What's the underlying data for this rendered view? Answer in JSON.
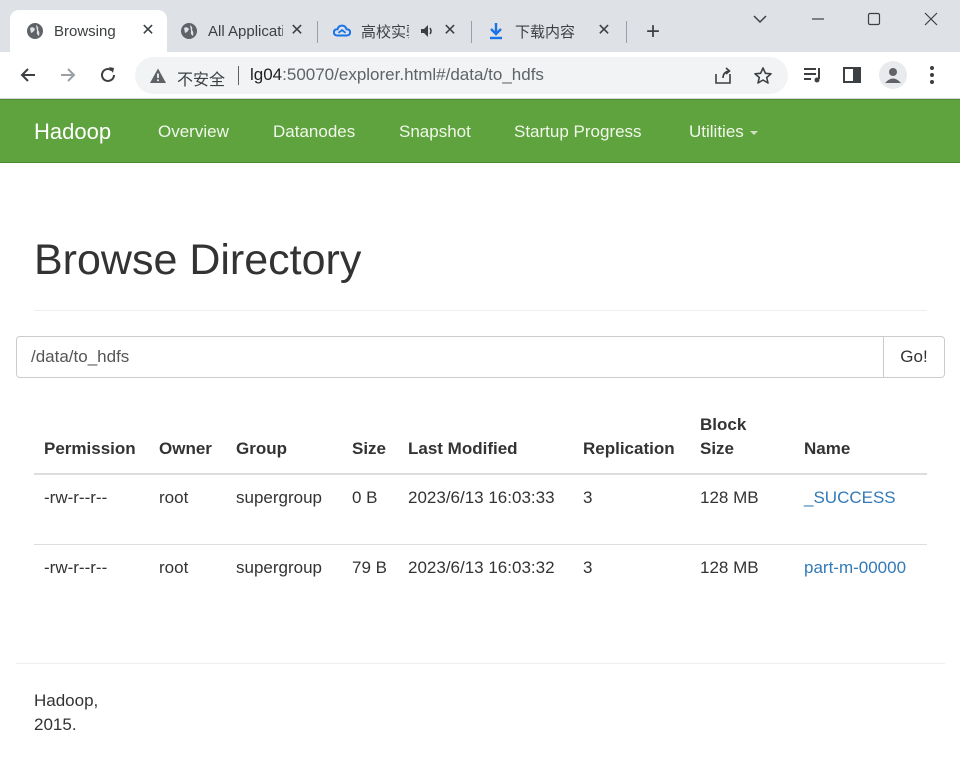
{
  "browser": {
    "tabs": [
      {
        "title": "Browsing HDFS",
        "icon": "globe-icon",
        "active": true
      },
      {
        "title": "All Applications",
        "icon": "globe-icon",
        "active": false
      },
      {
        "title": "高校实验",
        "icon": "cloud-icon",
        "active": false,
        "audio": true
      },
      {
        "title": "下载内容",
        "icon": "download-icon",
        "active": false
      }
    ],
    "address": {
      "insecure_label": "不安全",
      "host": "lg04",
      "rest": ":50070/explorer.html#/data/to_hdfs"
    }
  },
  "navbar": {
    "brand": "Hadoop",
    "links": [
      "Overview",
      "Datanodes",
      "Snapshot",
      "Startup Progress",
      "Utilities"
    ]
  },
  "page": {
    "title": "Browse Directory",
    "path_value": "/data/to_hdfs",
    "go_label": "Go!"
  },
  "table": {
    "headers": [
      "Permission",
      "Owner",
      "Group",
      "Size",
      "Last Modified",
      "Replication",
      "Block Size",
      "Name"
    ],
    "rows": [
      {
        "permission": "-rw-r--r--",
        "owner": "root",
        "group": "supergroup",
        "size": "0 B",
        "modified": "2023/6/13 16:03:33",
        "replication": "3",
        "block_size": "128 MB",
        "name": "_SUCCESS"
      },
      {
        "permission": "-rw-r--r--",
        "owner": "root",
        "group": "supergroup",
        "size": "79 B",
        "modified": "2023/6/13 16:03:32",
        "replication": "3",
        "block_size": "128 MB",
        "name": "part-m-00000"
      }
    ]
  },
  "footer": {
    "text": "Hadoop, 2015."
  },
  "colors": {
    "navbar": "#5fa33e",
    "link": "#337ab7",
    "tabstrip": "#dee1e6"
  }
}
